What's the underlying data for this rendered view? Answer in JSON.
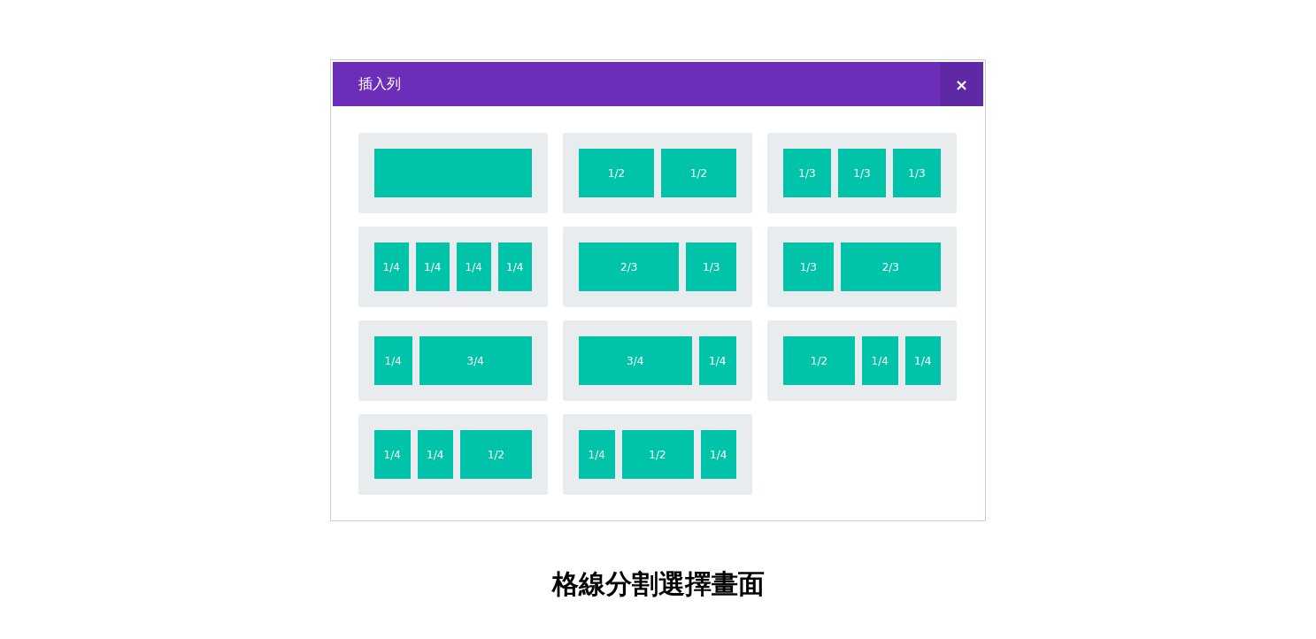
{
  "dialog": {
    "title": "插入列",
    "close": "×"
  },
  "layouts": [
    {
      "columns": [
        {}
      ]
    },
    {
      "columns": [
        {
          "label": "1/2"
        },
        {
          "label": "1/2"
        }
      ]
    },
    {
      "columns": [
        {
          "label": "1/3"
        },
        {
          "label": "1/3"
        },
        {
          "label": "1/3"
        }
      ]
    },
    {
      "columns": [
        {
          "label": "1/4"
        },
        {
          "label": "1/4"
        },
        {
          "label": "1/4"
        },
        {
          "label": "1/4"
        }
      ]
    },
    {
      "columns": [
        {
          "label": "2/3"
        },
        {
          "label": "1/3"
        }
      ]
    },
    {
      "columns": [
        {
          "label": "1/3"
        },
        {
          "label": "2/3"
        }
      ]
    },
    {
      "columns": [
        {
          "label": "1/4"
        },
        {
          "label": "3/4"
        }
      ]
    },
    {
      "columns": [
        {
          "label": "3/4"
        },
        {
          "label": "1/4"
        }
      ]
    },
    {
      "columns": [
        {
          "label": "1/2"
        },
        {
          "label": "1/4"
        },
        {
          "label": "1/4"
        }
      ]
    },
    {
      "columns": [
        {
          "label": "1/4"
        },
        {
          "label": "1/4"
        },
        {
          "label": "1/2"
        }
      ]
    },
    {
      "columns": [
        {
          "label": "1/4"
        },
        {
          "label": "1/2"
        },
        {
          "label": "1/4"
        }
      ]
    }
  ],
  "caption": "格線分割選擇畫面"
}
